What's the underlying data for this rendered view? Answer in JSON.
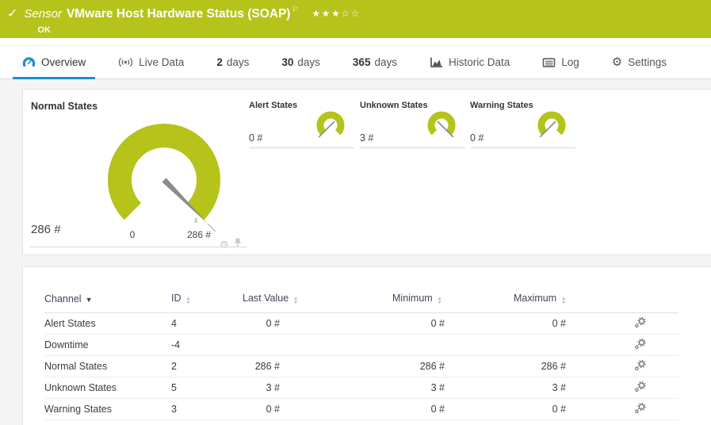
{
  "header": {
    "sensor_type": "Sensor",
    "title": "VMware Host Hardware Status (SOAP)",
    "status": "OK",
    "rating": {
      "filled": 3,
      "total": 5,
      "stars_filled": "★★★",
      "stars_empty": "☆☆"
    }
  },
  "tabs": [
    {
      "label": "Overview",
      "icon": "gauge-icon",
      "active": true
    },
    {
      "label": "Live Data",
      "icon": "live-data-icon",
      "active": false
    },
    {
      "value": "2",
      "label": "days",
      "active": false
    },
    {
      "value": "30",
      "label": "days",
      "active": false
    },
    {
      "value": "365",
      "label": "days",
      "active": false
    },
    {
      "label": "Historic Data",
      "icon": "area-chart-icon",
      "active": false
    },
    {
      "label": "Log",
      "icon": "log-icon",
      "active": false
    },
    {
      "label": "Settings",
      "icon": "gear-icon",
      "active": false
    }
  ],
  "colors": {
    "status_ok_green": "#b6c31a",
    "accent_blue": "#1892d0",
    "gauge_green": "#b5c31b",
    "needle_gray": "#8b8b8b"
  },
  "chart_data": [
    {
      "type": "gauge",
      "title": "Normal States",
      "value": 286,
      "unit": "#",
      "min": 0,
      "max": 286,
      "value_label": "286 #",
      "scale_min_label": "0",
      "scale_max_label": "286 #"
    },
    {
      "type": "gauge",
      "title": "Alert States",
      "value": 0,
      "unit": "#",
      "value_label": "0 #"
    },
    {
      "type": "gauge",
      "title": "Unknown States",
      "value": 3,
      "unit": "#",
      "value_label": "3 #"
    },
    {
      "type": "gauge",
      "title": "Warning States",
      "value": 0,
      "unit": "#",
      "value_label": "0 #"
    }
  ],
  "gauges": {
    "primary": {
      "title": "Normal States",
      "value": "286 #",
      "scale_min": "0",
      "scale_max": "286 #",
      "avg_marker": "x̄"
    },
    "secondary": [
      {
        "title": "Alert States",
        "value": "0 #"
      },
      {
        "title": "Unknown States",
        "value": "3 #"
      },
      {
        "title": "Warning States",
        "value": "0 #"
      }
    ]
  },
  "table": {
    "headers": {
      "channel": "Channel",
      "id": "ID",
      "last_value": "Last Value",
      "minimum": "Minimum",
      "maximum": "Maximum"
    },
    "rows": [
      {
        "channel": "Alert States",
        "id": "4",
        "last_value": "0 #",
        "minimum": "0 #",
        "maximum": "0 #"
      },
      {
        "channel": "Downtime",
        "id": "-4",
        "last_value": "",
        "minimum": "",
        "maximum": ""
      },
      {
        "channel": "Normal States",
        "id": "2",
        "last_value": "286 #",
        "minimum": "286 #",
        "maximum": "286 #"
      },
      {
        "channel": "Unknown States",
        "id": "5",
        "last_value": "3 #",
        "minimum": "3 #",
        "maximum": "3 #"
      },
      {
        "channel": "Warning States",
        "id": "3",
        "last_value": "0 #",
        "minimum": "0 #",
        "maximum": "0 #"
      }
    ]
  }
}
